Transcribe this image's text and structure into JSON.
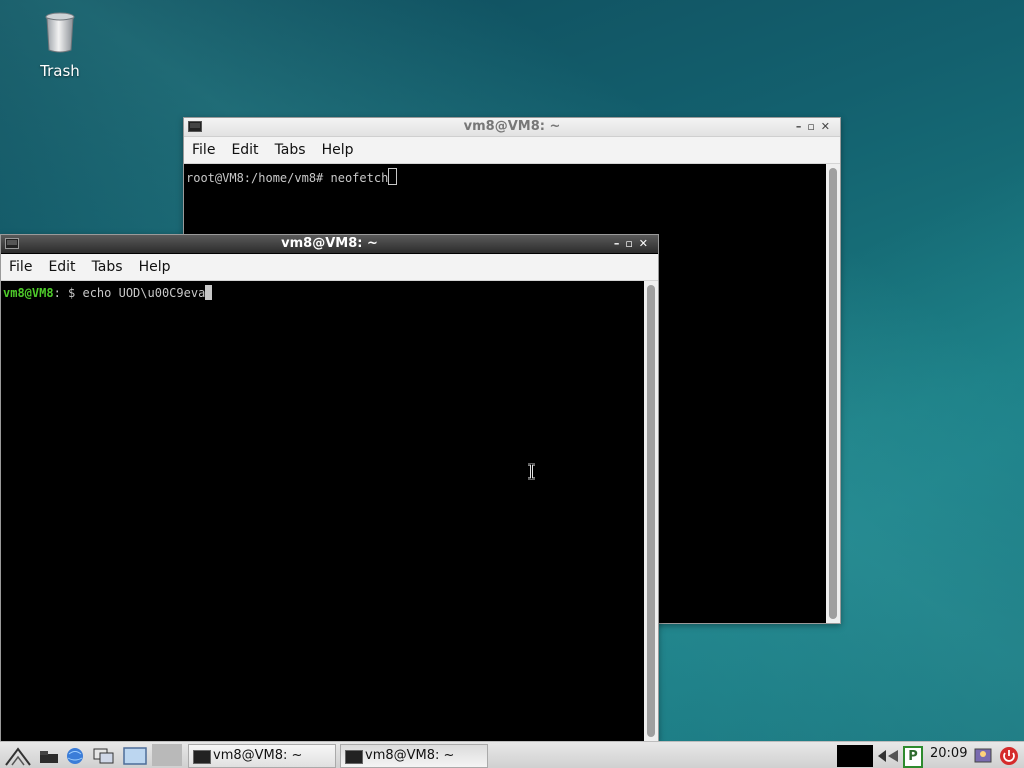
{
  "desktop": {
    "trash_label": "Trash"
  },
  "window_back": {
    "title": "vm8@VM8: ~",
    "menu": [
      "File",
      "Edit",
      "Tabs",
      "Help"
    ],
    "terminal_line": "root@VM8:/home/vm8# neofetch"
  },
  "window_front": {
    "title": "vm8@VM8: ~",
    "menu": [
      "File",
      "Edit",
      "Tabs",
      "Help"
    ],
    "prompt_user": "vm8@VM8",
    "prompt_rest": ": $ ",
    "command": "echo UOD\\u00C9eva"
  },
  "taskbar": {
    "tasks": [
      "vm8@VM8: ~",
      "vm8@VM8: ~"
    ],
    "clock": "20:09",
    "tray_letter": "P"
  },
  "colors": {
    "prompt_green": "#4ecb2a",
    "root_prompt_gray": "#c8c8c8",
    "taskbar_bg": "#d9d9d9"
  }
}
